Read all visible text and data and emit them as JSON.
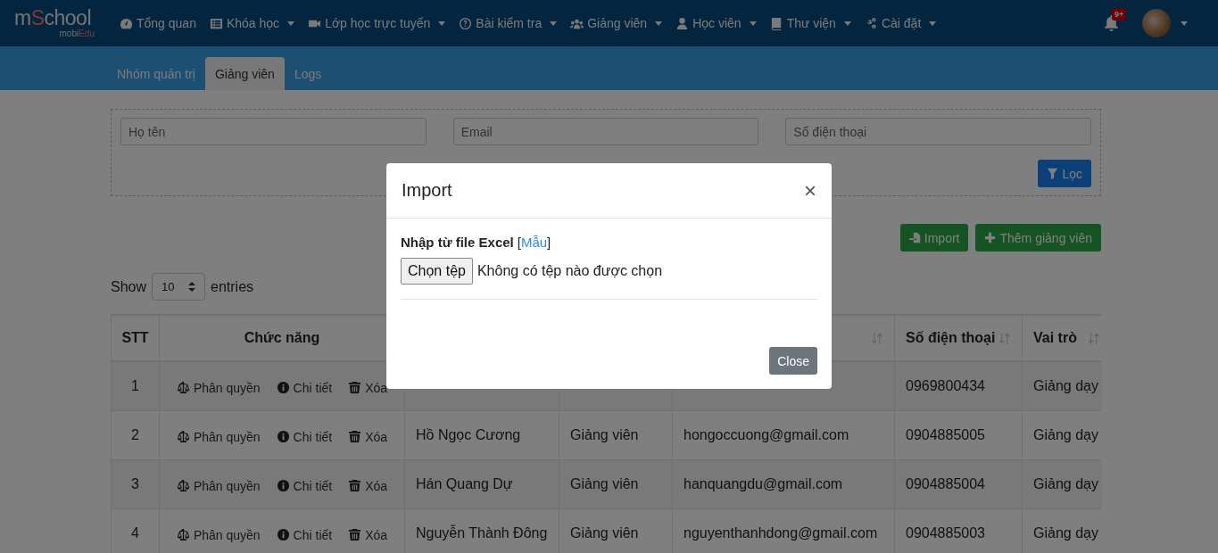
{
  "navbar": {
    "logo": {
      "prefix": "m",
      "highlight": "S",
      "suffix": "chool",
      "tagline_prefix": "mobi",
      "tagline_highlight": "Edu"
    },
    "menu": [
      {
        "label": "Tổng quan",
        "dropdown": false
      },
      {
        "label": "Khóa học",
        "dropdown": true
      },
      {
        "label": "Lớp học trực tuyến",
        "dropdown": true
      },
      {
        "label": "Bài kiểm tra",
        "dropdown": true
      },
      {
        "label": "Giảng viên",
        "dropdown": true
      },
      {
        "label": "Học viên",
        "dropdown": true
      },
      {
        "label": "Thư viện",
        "dropdown": true
      },
      {
        "label": "Cài đặt",
        "dropdown": true
      }
    ],
    "notifications": {
      "badge": "9+"
    }
  },
  "tabs": [
    {
      "label": "Nhóm quản trị",
      "selected": false
    },
    {
      "label": "Giảng viên",
      "selected": true
    },
    {
      "label": "Logs",
      "selected": false
    }
  ],
  "filters": {
    "fields": [
      {
        "placeholder": "Họ tên"
      },
      {
        "placeholder": "Email"
      },
      {
        "placeholder": "Số điện thoại"
      }
    ],
    "button": "Lọc"
  },
  "actions": [
    "Import",
    "Thêm giảng viên"
  ],
  "length_menu": {
    "before": "Show",
    "value": "10",
    "after": "entries"
  },
  "table": {
    "columns": [
      {
        "label": "STT",
        "sortable": false
      },
      {
        "label": "Chức năng",
        "sortable": false
      },
      {},
      {},
      {
        "sortable": true
      },
      {
        "label": "Số điện thoại",
        "sortable": true
      },
      {
        "label": "Vai trò",
        "sortable": true
      }
    ],
    "rows": [
      {
        "stt": "1",
        "actions": [
          "Phân quyền",
          "Chi tiết",
          "Xóa"
        ],
        "phone": "0969800434",
        "role": "Giảng dạy"
      },
      {
        "stt": "2",
        "actions": [
          "Phân quyền",
          "Chi tiết",
          "Xóa"
        ],
        "name": "Hồ Ngọc Cương",
        "position": "Giảng viên",
        "email": "hongoccuong@gmail.com",
        "phone": "0904885005",
        "role": "Giảng dạy"
      },
      {
        "stt": "3",
        "actions": [
          "Phân quyền",
          "Chi tiết",
          "Xóa"
        ],
        "name": "Hán Quang Dự",
        "position": "Giảng viên",
        "email": "hanquangdu@gmail.com",
        "phone": "0904885004",
        "role": "Giảng dạy"
      },
      {
        "stt": "4",
        "actions": [
          "Phân quyền",
          "Chi tiết",
          "Xóa"
        ],
        "name": "Nguyễn Thành Đông",
        "position": "Giảng viên",
        "email": "nguyenthanhdong@gmail.com",
        "phone": "0904885003",
        "role": "Giảng dạy"
      }
    ]
  },
  "modal": {
    "title": "Import",
    "close": "×",
    "label": "Nhập từ file Excel",
    "link_open": "[",
    "link": "Mẫu",
    "link_close": "]",
    "file_button": "Chọn tệp",
    "file_status": "Không có tệp nào được chọn",
    "close_button": "Close"
  }
}
